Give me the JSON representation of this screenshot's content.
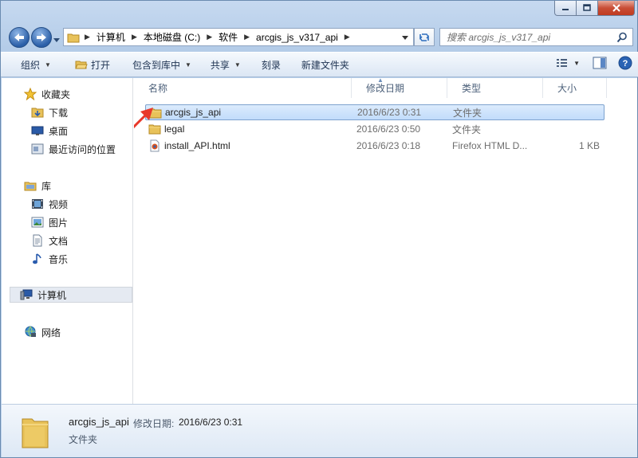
{
  "window": {
    "minimize_label": "–",
    "maximize_label": "□",
    "close_label": "✕"
  },
  "address": {
    "breadcrumbs": [
      "计算机",
      "本地磁盘 (C:)",
      "软件",
      "arcgis_js_v317_api"
    ],
    "search_placeholder": "搜索 arcgis_js_v317_api"
  },
  "toolbar": {
    "organize": "组织",
    "open": "打开",
    "include_in_library": "包含到库中",
    "share": "共享",
    "burn": "刻录",
    "new_folder": "新建文件夹"
  },
  "nav": {
    "favorites": "收藏夹",
    "downloads": "下载",
    "desktop": "桌面",
    "recent": "最近访问的位置",
    "libraries": "库",
    "videos": "视频",
    "pictures": "图片",
    "documents": "文档",
    "music": "音乐",
    "computer": "计算机",
    "network": "网络"
  },
  "columns": {
    "name": "名称",
    "modified": "修改日期",
    "type": "类型",
    "size": "大小"
  },
  "files": [
    {
      "name": "arcgis_js_api",
      "modified": "2016/6/23 0:31",
      "type": "文件夹",
      "size": "",
      "icon": "folder-icon",
      "selected": true
    },
    {
      "name": "legal",
      "modified": "2016/6/23 0:50",
      "type": "文件夹",
      "size": "",
      "icon": "folder-icon",
      "selected": false
    },
    {
      "name": "install_API.html",
      "modified": "2016/6/23 0:18",
      "type": "Firefox HTML D...",
      "size": "1 KB",
      "icon": "html-file-icon",
      "selected": false
    }
  ],
  "details": {
    "name": "arcgis_js_api",
    "modified_label": "修改日期:",
    "modified_value": "2016/6/23 0:31",
    "type": "文件夹"
  },
  "colors": {
    "accent": "#3d6fb3",
    "selection": "#cce0fa",
    "arrow": "#e8382a",
    "folder": "#e8c25a"
  }
}
